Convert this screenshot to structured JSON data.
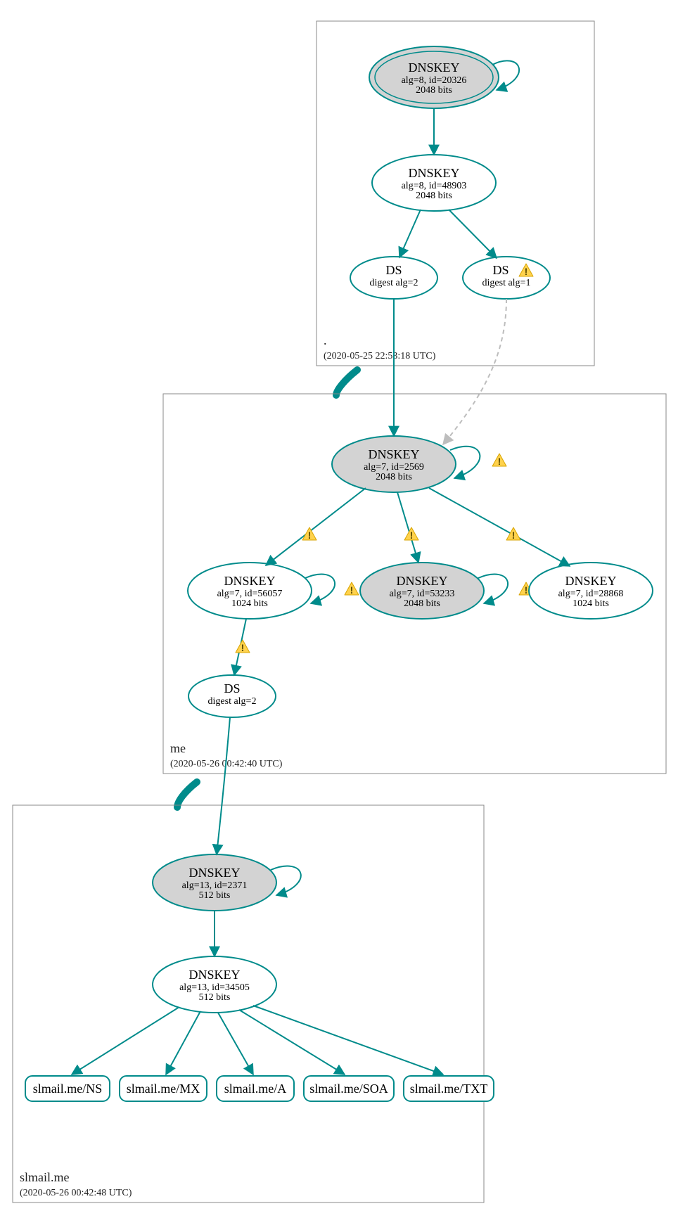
{
  "colors": {
    "stroke": "#008b8b",
    "grey_fill": "#d3d3d3",
    "dashed": "#bdbdbd",
    "warn": "#ffd24d"
  },
  "zones": {
    "root": {
      "name": ".",
      "timestamp": "(2020-05-25 22:53:18 UTC)"
    },
    "me": {
      "name": "me",
      "timestamp": "(2020-05-26 00:42:40 UTC)"
    },
    "slmail": {
      "name": "slmail.me",
      "timestamp": "(2020-05-26 00:42:48 UTC)"
    }
  },
  "nodes": {
    "root_ksk": {
      "title": "DNSKEY",
      "line1": "alg=8, id=20326",
      "line2": "2048 bits"
    },
    "root_zsk": {
      "title": "DNSKEY",
      "line1": "alg=8, id=48903",
      "line2": "2048 bits"
    },
    "root_ds1": {
      "title": "DS",
      "line1": "digest alg=2"
    },
    "root_ds2": {
      "title": "DS",
      "line1": "digest alg=1"
    },
    "me_ksk": {
      "title": "DNSKEY",
      "line1": "alg=7, id=2569",
      "line2": "2048 bits"
    },
    "me_left": {
      "title": "DNSKEY",
      "line1": "alg=7, id=56057",
      "line2": "1024 bits"
    },
    "me_mid": {
      "title": "DNSKEY",
      "line1": "alg=7, id=53233",
      "line2": "2048 bits"
    },
    "me_right": {
      "title": "DNSKEY",
      "line1": "alg=7, id=28868",
      "line2": "1024 bits"
    },
    "me_ds": {
      "title": "DS",
      "line1": "digest alg=2"
    },
    "sl_ksk": {
      "title": "DNSKEY",
      "line1": "alg=13, id=2371",
      "line2": "512 bits"
    },
    "sl_zsk": {
      "title": "DNSKEY",
      "line1": "alg=13, id=34505",
      "line2": "512 bits"
    }
  },
  "rrsets": {
    "ns": "slmail.me/NS",
    "mx": "slmail.me/MX",
    "a": "slmail.me/A",
    "soa": "slmail.me/SOA",
    "txt": "slmail.me/TXT"
  }
}
